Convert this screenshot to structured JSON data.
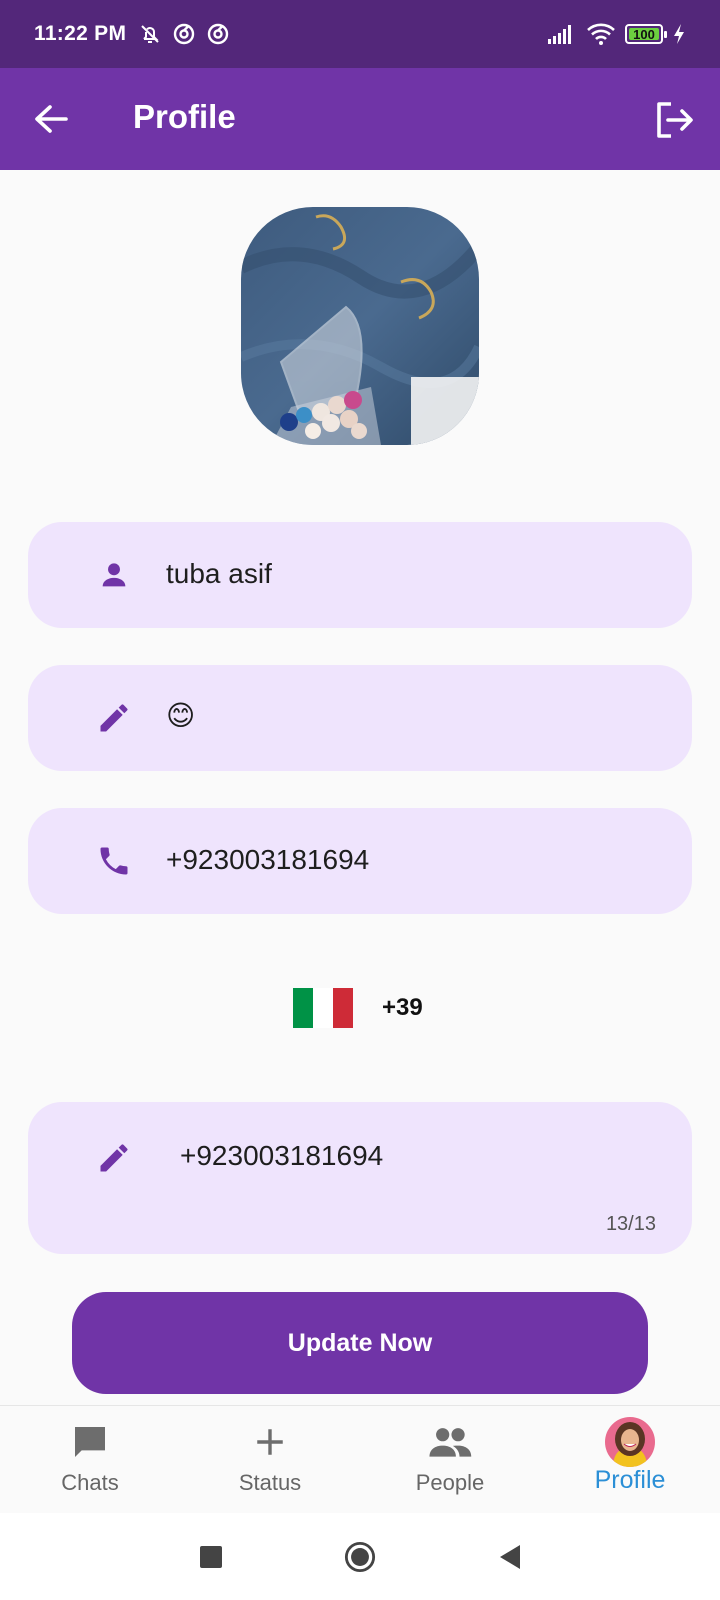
{
  "status_bar": {
    "time": "11:22 PM",
    "battery": "100"
  },
  "app_bar": {
    "title": "Profile"
  },
  "profile": {
    "name": "tuba asif",
    "about": "😊",
    "phone": "+923003181694"
  },
  "country_picker": {
    "dial_code": "+39",
    "flag_colors": [
      "#009246",
      "#ffffff",
      "#ce2b37"
    ]
  },
  "edit_field": {
    "value": "+923003181694",
    "counter": "13/13"
  },
  "update_button": {
    "label": "Update Now"
  },
  "bottom_nav": {
    "items": [
      {
        "label": "Chats",
        "icon": "chat-icon"
      },
      {
        "label": "Status",
        "icon": "plus-icon"
      },
      {
        "label": "People",
        "icon": "people-icon"
      },
      {
        "label": "Profile",
        "icon": "profile-avatar",
        "active": true
      }
    ]
  },
  "colors": {
    "primary": "#7034a7",
    "status_bar": "#53277a",
    "field_bg": "#efe4fd",
    "active_nav": "#2b8fd6"
  }
}
